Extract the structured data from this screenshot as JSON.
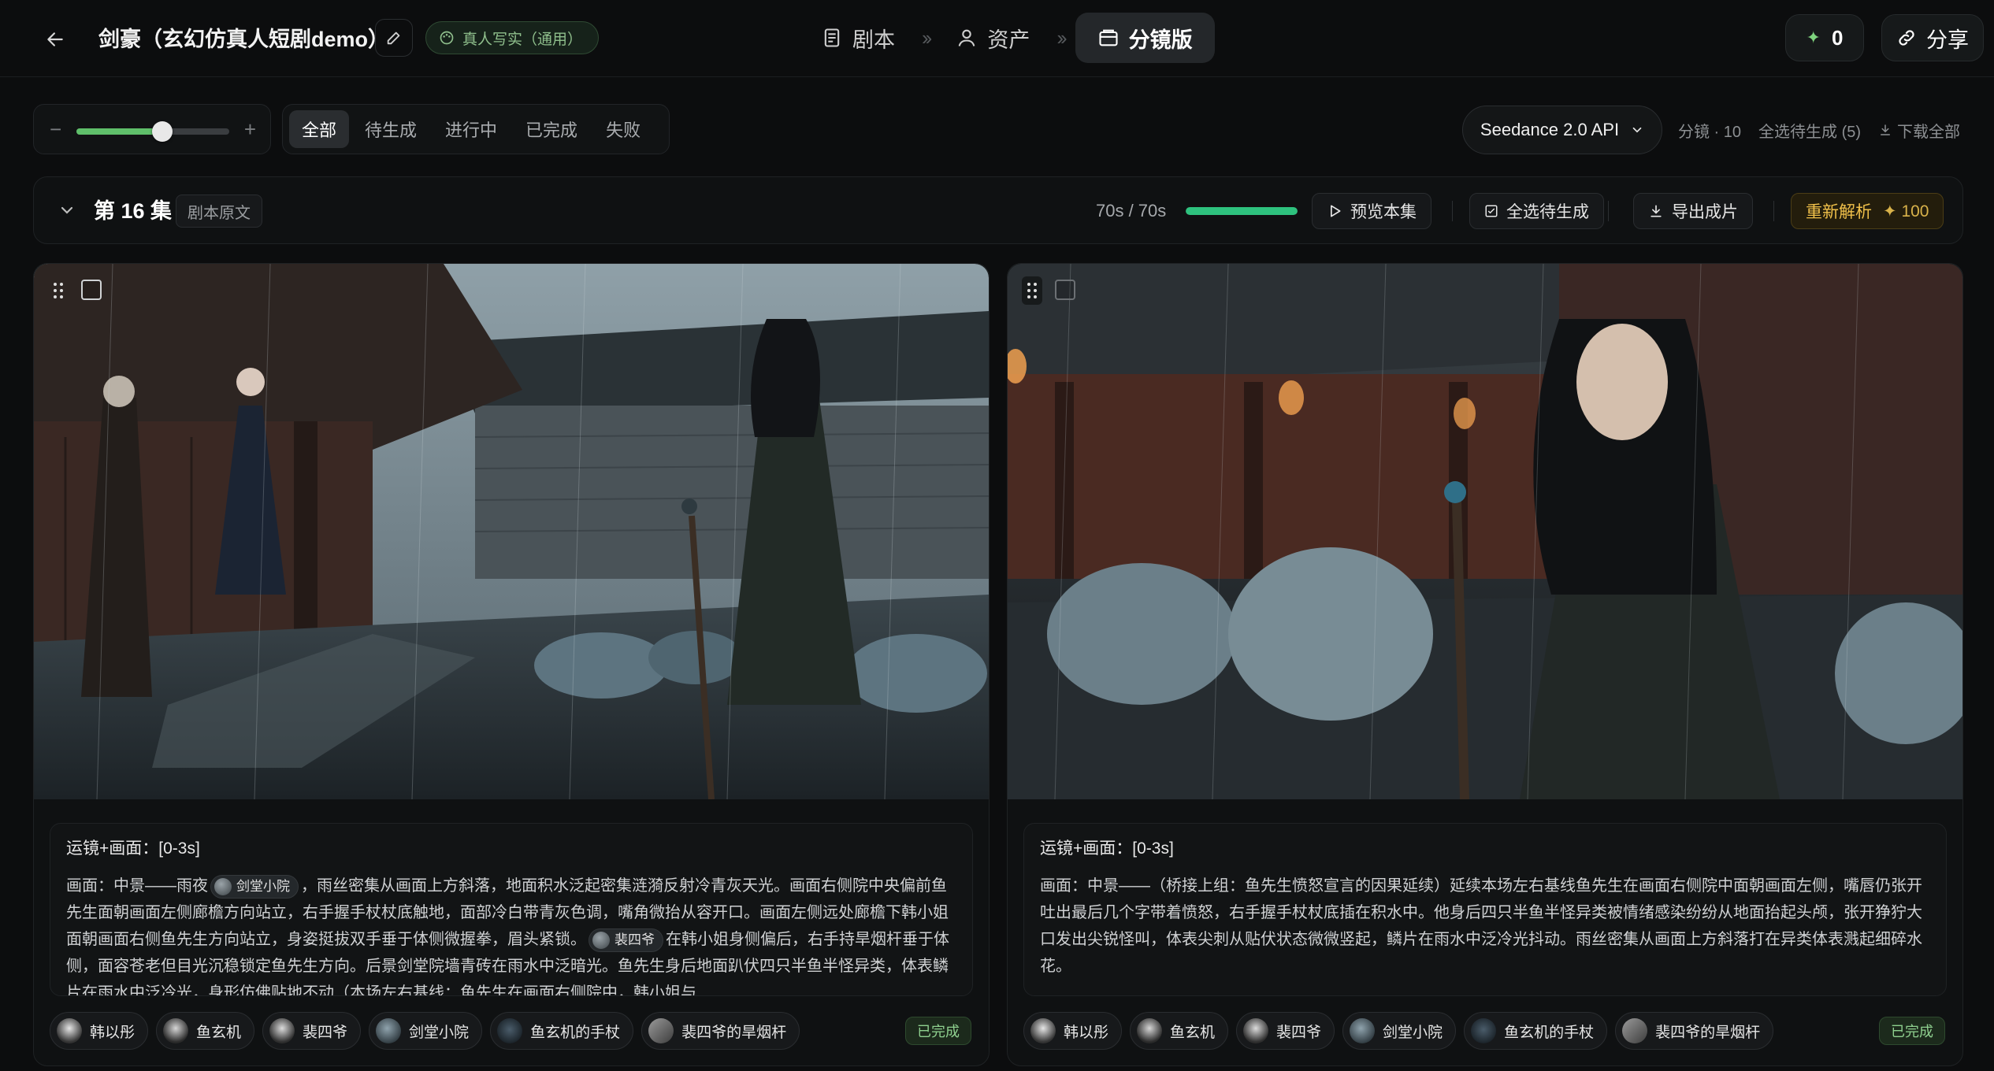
{
  "topbar": {
    "project_title": "剑豪（玄幻仿真人短剧demo）",
    "style_badge": "真人写实（通用）",
    "nav": [
      {
        "label": "剧本",
        "icon": "script-icon"
      },
      {
        "label": "资产",
        "icon": "user-icon"
      },
      {
        "label": "分镜版",
        "icon": "storyboard-icon",
        "active": true
      }
    ],
    "credits": "0",
    "share_label": "分享"
  },
  "toolbar": {
    "zoom_minus": "−",
    "zoom_plus": "+",
    "zoom_level": 0.56,
    "filters": [
      "全部",
      "待生成",
      "进行中",
      "已完成",
      "失败"
    ],
    "active_filter": "全部",
    "model": "Seedance 2.0 API",
    "shot_count": "分镜 · 10",
    "select_pending": "全选待生成 (5)",
    "download_all": "下载全部"
  },
  "episode": {
    "title": "第 16 集",
    "source_label": "剧本原文",
    "time": "70s / 70s",
    "progress": 1.0,
    "preview_label": "预览本集",
    "select_pending_label": "全选待生成",
    "export_label": "导出成片",
    "reparse_label": "重新解析",
    "reparse_cost": "100"
  },
  "shots": [
    {
      "header": "运镜+画面：[0-3s]",
      "body": [
        {
          "t": "text",
          "v": "画面：中景——雨夜"
        },
        {
          "t": "chip",
          "v": "剑堂小院"
        },
        {
          "t": "text",
          "v": "，雨丝密集从画面上方斜落，地面积水泛起密集涟漪反射冷青灰天光。画面右侧院中央偏前鱼先生面朝画面左侧廊檐方向站立，右手握手杖杖底触地，面部冷白带青灰色调，嘴角微抬从容开口。画面左侧远处廊檐下韩小姐面朝画面右侧鱼先生方向站立，身姿挺拔双手垂于体侧微握拳，眉头紧锁。"
        },
        {
          "t": "chip",
          "v": "裴四爷"
        },
        {
          "t": "text",
          "v": "在韩小姐身侧偏后，右手持旱烟杆垂于体侧，面容苍老但目光沉稳锁定鱼先生方向。后景剑堂院墙青砖在雨水中泛暗光。鱼先生身后地面趴伏四只半鱼半怪异类，体表鳞片在雨水中泛冷光，身形仿佛贴地不动（本场左右基线：鱼先生在画面右侧院中，韩小姐与"
        }
      ],
      "tags": [
        "韩以彤",
        "鱼玄机",
        "裴四爷",
        "剑堂小院",
        "鱼玄机的手杖",
        "裴四爷的旱烟杆"
      ],
      "status": "已完成"
    },
    {
      "header": "运镜+画面：[0-3s]",
      "body": [
        {
          "t": "text",
          "v": "画面：中景——（桥接上组：鱼先生愤怒宣言的因果延续）延续本场左右基线鱼先生在画面右侧院中面朝画面左侧，嘴唇仍张开吐出最后几个字带着愤怒，右手握手杖杖底插在积水中。他身后四只半鱼半怪异类被情绪感染纷纷从地面抬起头颅，张开狰狞大口发出尖锐怪叫，体表尖刺从贴伏状态微微竖起，鳞片在雨水中泛冷光抖动。雨丝密集从画面上方斜落打在异类体表溅起细碎水花。"
        }
      ],
      "tags": [
        "韩以彤",
        "鱼玄机",
        "裴四爷",
        "剑堂小院",
        "鱼玄机的手杖",
        "裴四爷的旱烟杆"
      ],
      "status": "已完成"
    }
  ]
}
